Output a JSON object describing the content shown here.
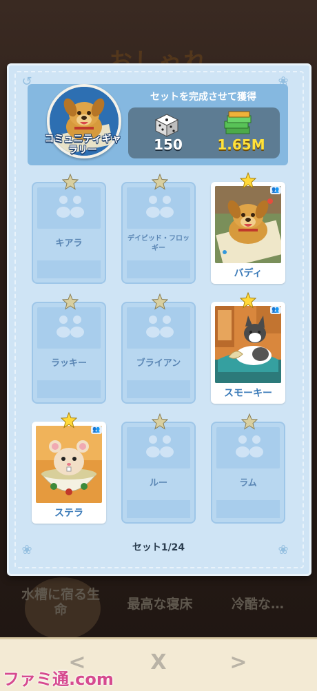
{
  "background": {
    "title": "おしゃれ",
    "labels": [
      "水槽に宿る生命",
      "最高な寝床",
      "冷酷な…"
    ]
  },
  "panel": {
    "header_text": "セットを完成させて獲得",
    "avatar_label": "コミュニティギャラリー",
    "rewards": [
      {
        "icon": "dice-icon",
        "value": "150"
      },
      {
        "icon": "money-stack-icon",
        "value": "1.65M"
      }
    ],
    "cards": [
      {
        "name": "キアラ",
        "owned": false
      },
      {
        "name": "デイビッド・フロッギー",
        "owned": false
      },
      {
        "name": "バディ",
        "owned": true,
        "art": "dog-art"
      },
      {
        "name": "ラッキー",
        "owned": false
      },
      {
        "name": "ブライアン",
        "owned": false
      },
      {
        "name": "スモーキー",
        "owned": true,
        "art": "cat-art"
      },
      {
        "name": "ステラ",
        "owned": true,
        "art": "hamster-art"
      },
      {
        "name": "ルー",
        "owned": false
      },
      {
        "name": "ラム",
        "owned": false
      }
    ],
    "set_progress": "セット1/24"
  },
  "nav": {
    "prev": "<",
    "close": "X",
    "next": ">"
  },
  "watermark": "ファミ通.com",
  "colors": {
    "panel": "#cfe4f5",
    "header": "#85b8e0",
    "money": "#ffe23b",
    "card_text": "#3a7ab8"
  }
}
